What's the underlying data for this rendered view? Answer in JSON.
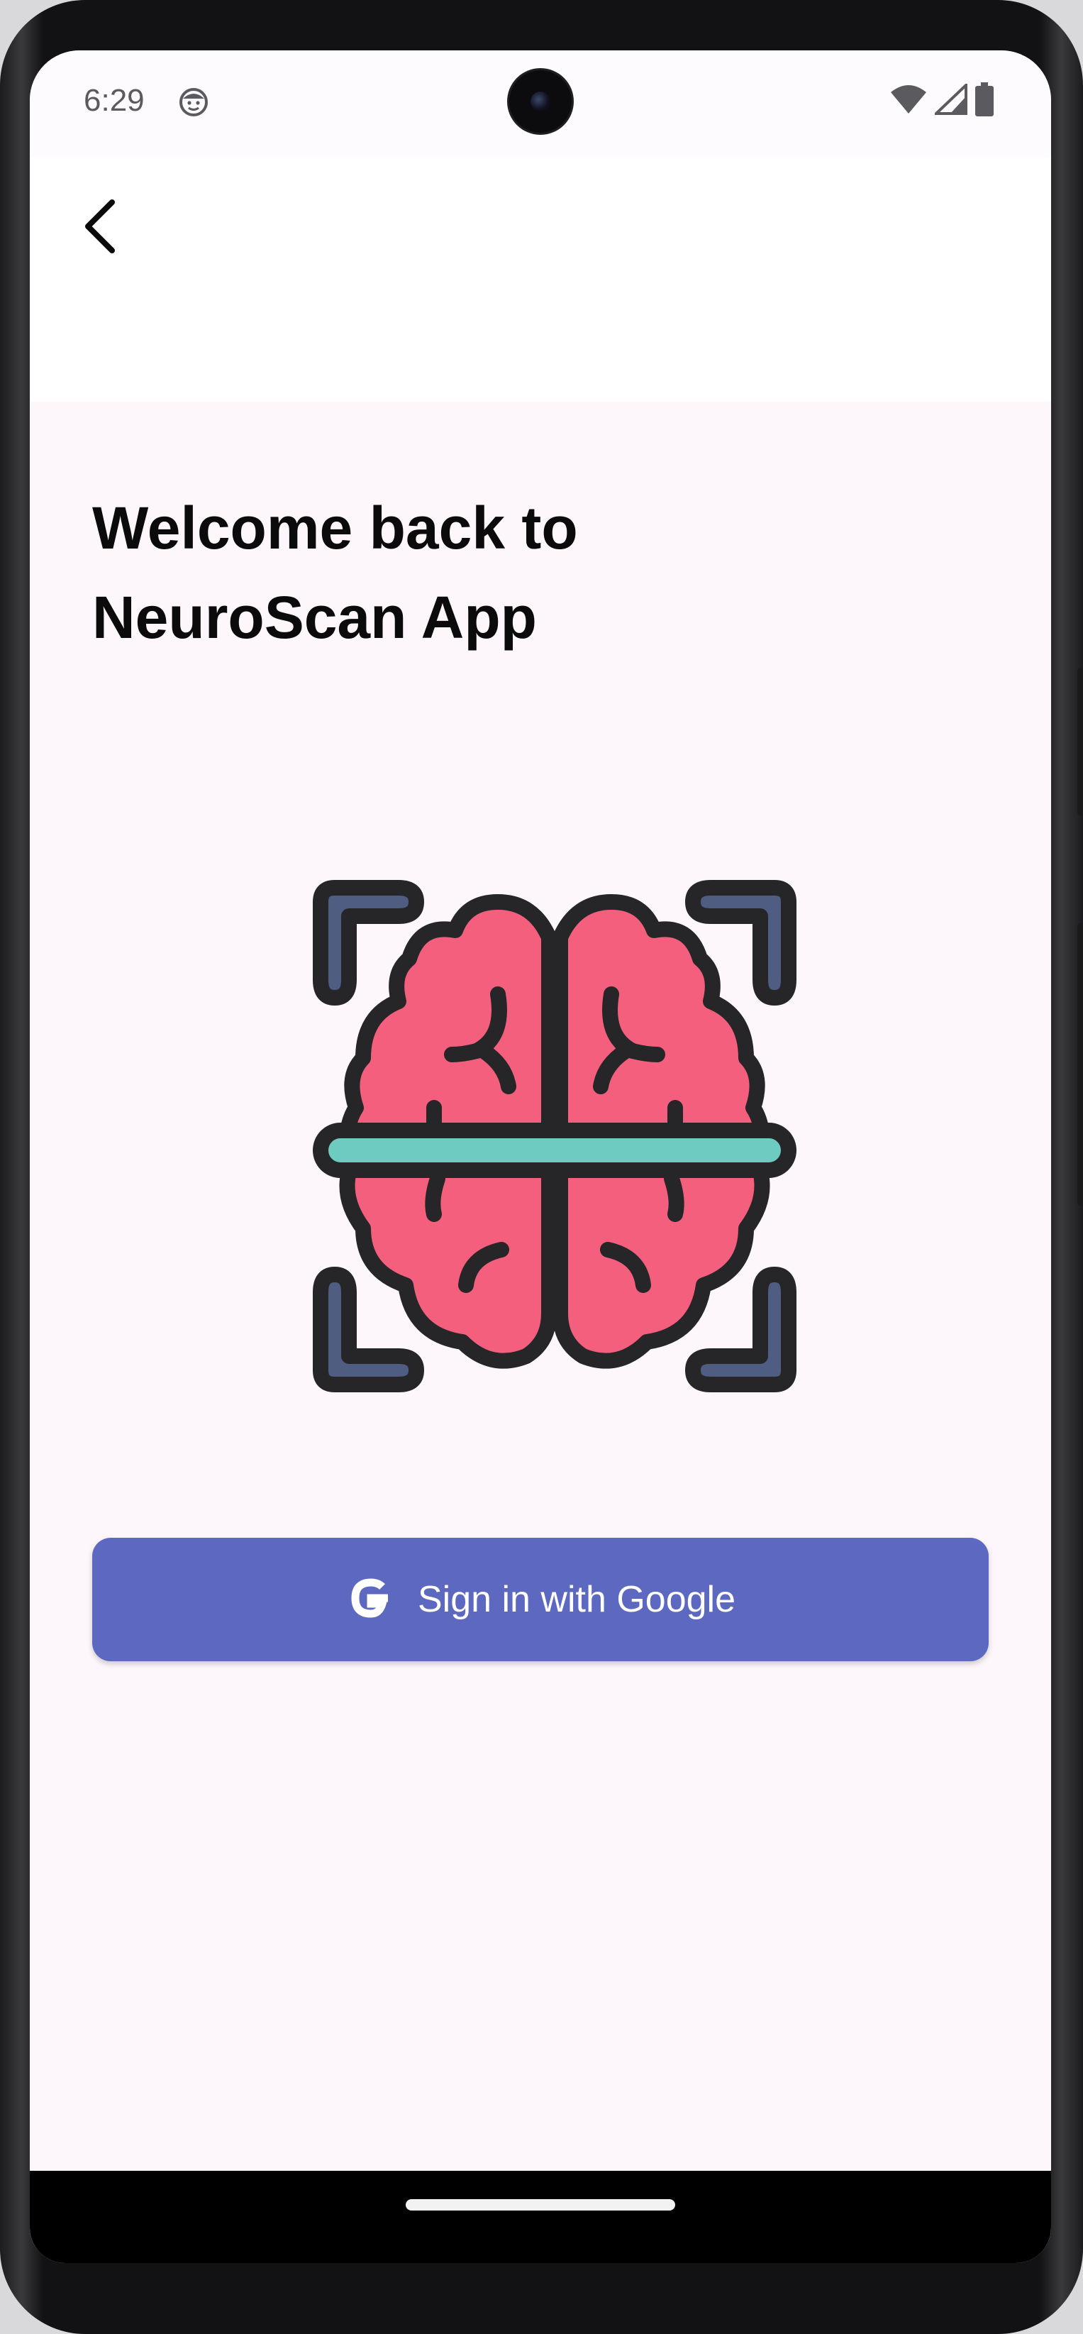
{
  "status_bar": {
    "time": "6:29",
    "icons": [
      "face-notification-icon",
      "wifi-icon",
      "cellular-signal-icon",
      "battery-icon"
    ]
  },
  "app_bar": {
    "back_icon": "chevron-left-icon"
  },
  "welcome": {
    "line1": "Welcome back to",
    "line2": "NeuroScan App"
  },
  "illustration": {
    "icon": "brain-scan-icon",
    "colors": {
      "brain": "#f45f7e",
      "scan_line": "#6ecbc2",
      "corners": "#4f5d82",
      "outline": "#262628"
    }
  },
  "sign_in": {
    "label": "Sign in with Google",
    "icon": "google-g-icon",
    "color": "#5d68c0"
  },
  "colors": {
    "background": "#fdf7fc",
    "appbar": "#ffffff"
  }
}
